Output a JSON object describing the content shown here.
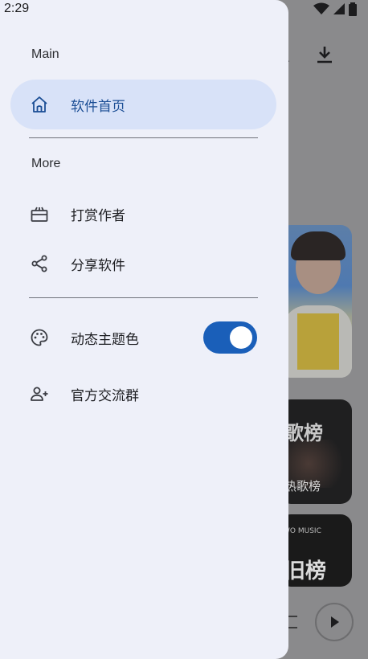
{
  "status_bar": {
    "time": "2:29"
  },
  "drawer": {
    "main_section_label": "Main",
    "more_section_label": "More",
    "items": [
      {
        "label": "软件首页",
        "icon": "home-icon",
        "active": true
      },
      {
        "label": "打赏作者",
        "icon": "gift-icon"
      },
      {
        "label": "分享软件",
        "icon": "share-icon"
      },
      {
        "label": "动态主题色",
        "icon": "palette-icon",
        "toggle_on": true
      },
      {
        "label": "官方交流群",
        "icon": "add-user-icon"
      }
    ]
  },
  "background": {
    "card2_title": "歌榜",
    "card2_subtitle": "热歌榜",
    "card3_small": "WO MUSIC",
    "card3_big": "旧榜"
  },
  "colors": {
    "drawer_bg": "#eef0f9",
    "active_bg": "#d8e2f8",
    "accent": "#1a5fb9"
  }
}
